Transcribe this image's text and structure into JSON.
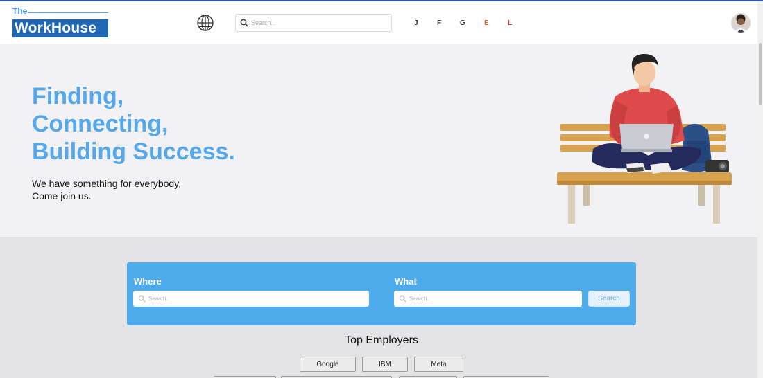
{
  "navbar": {
    "logo": {
      "the": "The",
      "name": "WorkHouse"
    },
    "search": {
      "placeholder": "Search..."
    },
    "letters": [
      {
        "label": "J",
        "color": "#333333"
      },
      {
        "label": "F",
        "color": "#333333"
      },
      {
        "label": "G",
        "color": "#333333"
      },
      {
        "label": "E",
        "color": "#e8692a"
      },
      {
        "label": "L",
        "color": "#d0342c"
      }
    ]
  },
  "hero": {
    "title_lines": [
      "Finding,",
      "Connecting,",
      "Building Success."
    ],
    "subtitle_lines": [
      "We have something for everybody,",
      "Come join us."
    ]
  },
  "search_panel": {
    "where_label": "Where",
    "where_placeholder": "Search...",
    "what_label": "What",
    "what_placeholder": "Search...",
    "button_label": "Search"
  },
  "employers": {
    "title": "Top Employers",
    "items": [
      "Google",
      "IBM",
      "Meta"
    ]
  },
  "colors": {
    "brand": "#1f67b3",
    "accent": "#4dabec",
    "hero_title": "#55a9ea"
  }
}
